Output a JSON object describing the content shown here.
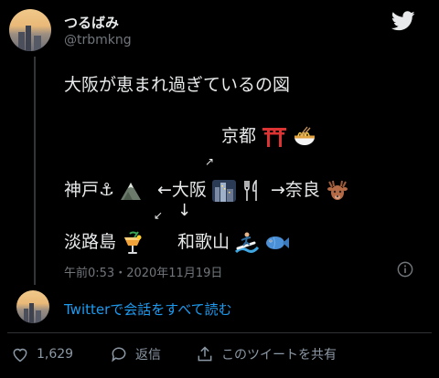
{
  "user": {
    "display_name": "つるばみ",
    "handle": "@trbmkng"
  },
  "tweet": {
    "title": "大阪が恵まれ過ぎているの図",
    "map": {
      "kyoto": "京都",
      "kobe": "神戸⚓",
      "osaka": "←大阪",
      "nara": "→奈良",
      "awaji": "淡路島",
      "wakayama": "和歌山",
      "arrow_up_right": "↗",
      "arrow_down_left": "↙",
      "arrow_down": "↓"
    },
    "timestamp": "午前0:53・2020年11月19日"
  },
  "conversation_link": "Twitterで会話をすべて読む",
  "actions": {
    "like_count": "1,629",
    "reply_label": "返信",
    "share_label": "このツイートを共有"
  },
  "icons": [
    "twitter-bird-icon",
    "info-icon",
    "heart-icon",
    "reply-icon",
    "share-icon"
  ],
  "colors": {
    "background": "#000000",
    "text": "#e7e9ea",
    "muted": "#71767b",
    "link": "#1d9bf0",
    "twitter_blue": "#1d9bf0"
  }
}
